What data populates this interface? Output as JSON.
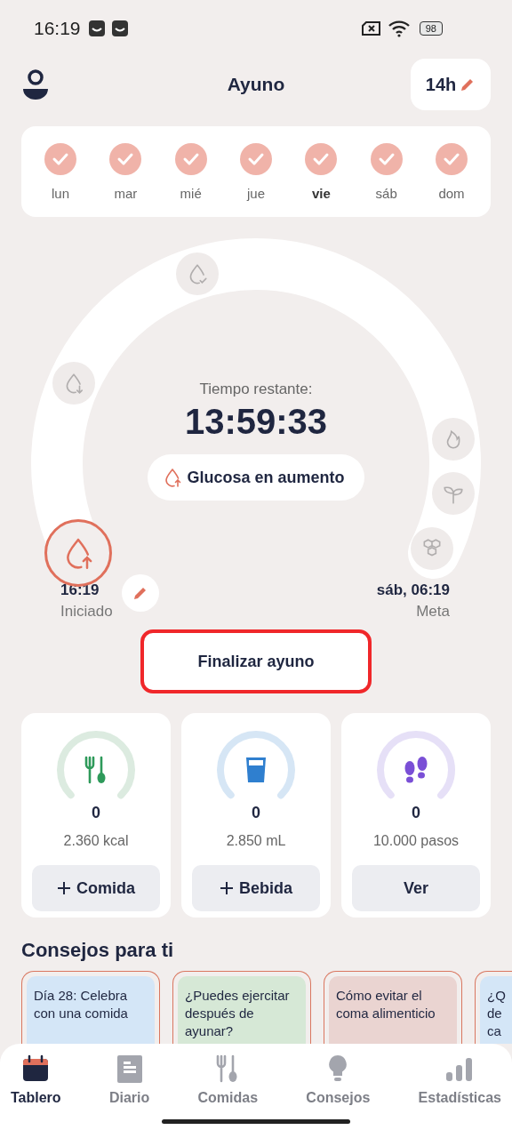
{
  "status_bar": {
    "time": "16:19",
    "battery": "98"
  },
  "header": {
    "title": "Ayuno",
    "goal_button": "14h"
  },
  "week": [
    {
      "label": "lun",
      "checked": true,
      "today": false
    },
    {
      "label": "mar",
      "checked": true,
      "today": false
    },
    {
      "label": "mié",
      "checked": true,
      "today": false
    },
    {
      "label": "jue",
      "checked": true,
      "today": false
    },
    {
      "label": "vie",
      "checked": true,
      "today": true
    },
    {
      "label": "sáb",
      "checked": true,
      "today": false
    },
    {
      "label": "dom",
      "checked": true,
      "today": false
    }
  ],
  "timer": {
    "label": "Tiempo restante:",
    "remaining": "13:59:33",
    "stage_label": "Glucosa en aumento",
    "stages": [
      {
        "kind": "drop-up",
        "current": true
      },
      {
        "kind": "drop-down",
        "current": false
      },
      {
        "kind": "drop-check",
        "current": false
      },
      {
        "kind": "flame",
        "current": false
      },
      {
        "kind": "sprout",
        "current": false
      },
      {
        "kind": "hexagons",
        "current": false
      }
    ],
    "start_time": "16:19",
    "start_label": "Iniciado",
    "goal_time": "sáb, 06:19",
    "goal_label": "Meta"
  },
  "end_button": {
    "label": "Finalizar ayuno",
    "highlighted": true
  },
  "trackers": [
    {
      "kind": "food",
      "value": "0",
      "target": "2.360 kcal",
      "button": "Comida",
      "plus": true
    },
    {
      "kind": "water",
      "value": "0",
      "target": "2.850 mL",
      "button": "Bebida",
      "plus": true
    },
    {
      "kind": "steps",
      "value": "0",
      "target": "10.000 pasos",
      "button": "Ver",
      "plus": false
    }
  ],
  "tips_title": "Consejos para ti",
  "tips": [
    {
      "lines": [
        "Día 28: Celebra",
        "con una comida"
      ],
      "color": "#d4e6f7"
    },
    {
      "lines": [
        "¿Puedes ejercitar",
        "después de",
        "ayunar?"
      ],
      "color": "#d6e8d6"
    },
    {
      "lines": [
        "Cómo evitar el",
        "coma alimenticio"
      ],
      "color": "#ead4d1"
    },
    {
      "lines": [
        "¿Q",
        "de",
        "ca"
      ],
      "color": "#d4e6f7"
    }
  ],
  "nav": [
    {
      "kind": "calendar",
      "label": "Tablero",
      "selected": true
    },
    {
      "kind": "document",
      "label": "Diario",
      "selected": false
    },
    {
      "kind": "utensils",
      "label": "Comidas",
      "selected": false
    },
    {
      "kind": "bulb",
      "label": "Consejos",
      "selected": false
    },
    {
      "kind": "bars",
      "label": "Estadísticas",
      "selected": false
    }
  ]
}
